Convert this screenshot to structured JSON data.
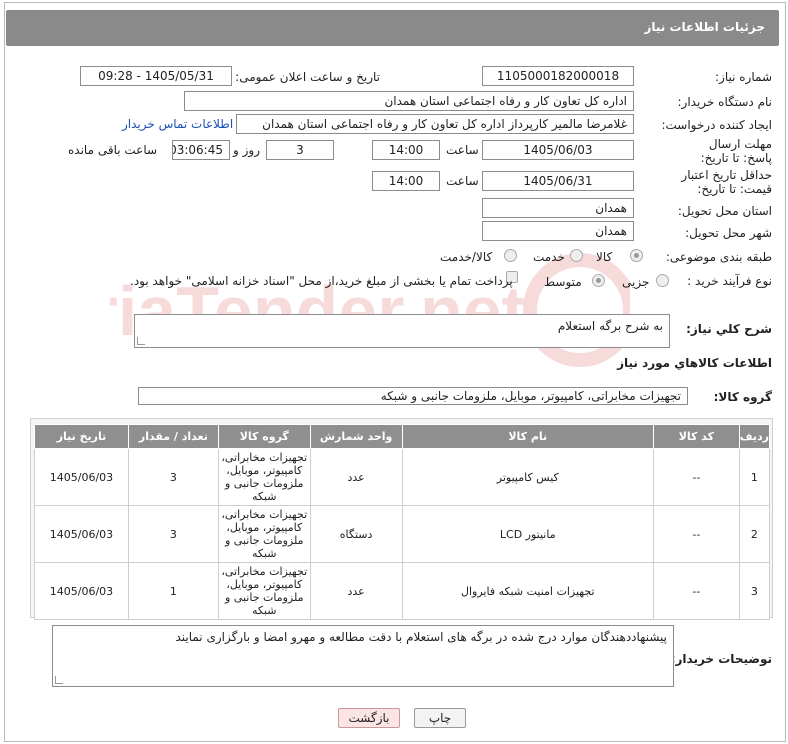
{
  "header": {
    "title": "جزئیات اطلاعات نیاز"
  },
  "form": {
    "need_number_label": "شماره نیاز:",
    "need_number": "1105000182000018",
    "announce_label": "تاریخ و ساعت اعلان عمومی:",
    "announce_value": "1405/05/31 - 09:28",
    "buyer_org_label": "نام دستگاه خریدار:",
    "buyer_org": "اداره کل تعاون  کار و رفاه اجتماعی استان همدان",
    "creator_label": "ایجاد کننده درخواست:",
    "creator": "غلامرضا مالمیر کارپرداز اداره کل تعاون  کار و رفاه اجتماعی استان همدان",
    "contact_link": "اطلاعات تماس خریدار",
    "deadline_label": "مهلت ارسال پاسخ: تا تاریخ:",
    "deadline_date": "1405/06/03",
    "time_label": "ساعت",
    "deadline_time": "14:00",
    "days": "3",
    "days_label": "روز و",
    "remaining": "03:06:45",
    "remaining_label": "ساعت باقی مانده",
    "validity_label": "حداقل تاریخ اعتبار قیمت: تا تاریخ:",
    "validity_date": "1405/06/31",
    "validity_time": "14:00",
    "province_label": "استان محل تحویل:",
    "province": "همدان",
    "city_label": "شهر محل تحویل:",
    "city": "همدان",
    "category_label": "طبقه بندی موضوعی:",
    "cat_goods": "کالا",
    "cat_service": "خدمت",
    "cat_both": "کالا/خدمت",
    "process_label": "نوع فرآیند خرید :",
    "proc_partial": "جزیی",
    "proc_medium": "متوسط",
    "payment_note": "پرداخت تمام یا بخشی از مبلغ خرید،از محل \"اسناد خزانه اسلامی\" خواهد بود."
  },
  "summary": {
    "label": "شرح کلي نياز:",
    "value": "به شرح برگه استعلام"
  },
  "goods": {
    "section_title": "اطلاعات کالاهاي مورد نياز",
    "group_label": "گروه کالا:",
    "group_value": "تجهیزات مخابراتی، کامپیوتر، موبایل، ملزومات جانبی و شبکه"
  },
  "table": {
    "headers": [
      "ردیف",
      "کد کالا",
      "نام کالا",
      "واحد شمارش",
      "گروه کالا",
      "تعداد / مقدار",
      "تاریخ نیاز"
    ],
    "rows": [
      [
        "1",
        "--",
        "کیس کامپیوتر",
        "عدد",
        "تجهیزات مخابراتی، کامپیوتر، موبایل، ملزومات جانبی و شبکه",
        "3",
        "1405/06/03"
      ],
      [
        "2",
        "--",
        "مانیتور LCD",
        "دستگاه",
        "تجهیزات مخابراتی، کامپیوتر، موبایل، ملزومات جانبی و شبکه",
        "3",
        "1405/06/03"
      ],
      [
        "3",
        "--",
        "تجهیزات امنیت شبکه فایروال",
        "عدد",
        "تجهیزات مخابراتی، کامپیوتر، موبایل، ملزومات جانبی و شبکه",
        "1",
        "1405/06/03"
      ]
    ]
  },
  "buyer_notes": {
    "label": "توضیحات خریدار:",
    "value": "پیشنهاددهندگان موارد درج شده در برگه های استعلام با دقت مطالعه و مهرو امضا و بارگزاری نمایند"
  },
  "buttons": {
    "print": "چاپ",
    "back": "بازگشت"
  },
  "watermark_text": "AriaTender.net",
  "colors": {
    "header": "#8a8a8a",
    "link": "#1a4fb5",
    "back_button": "#fbe4e4"
  }
}
